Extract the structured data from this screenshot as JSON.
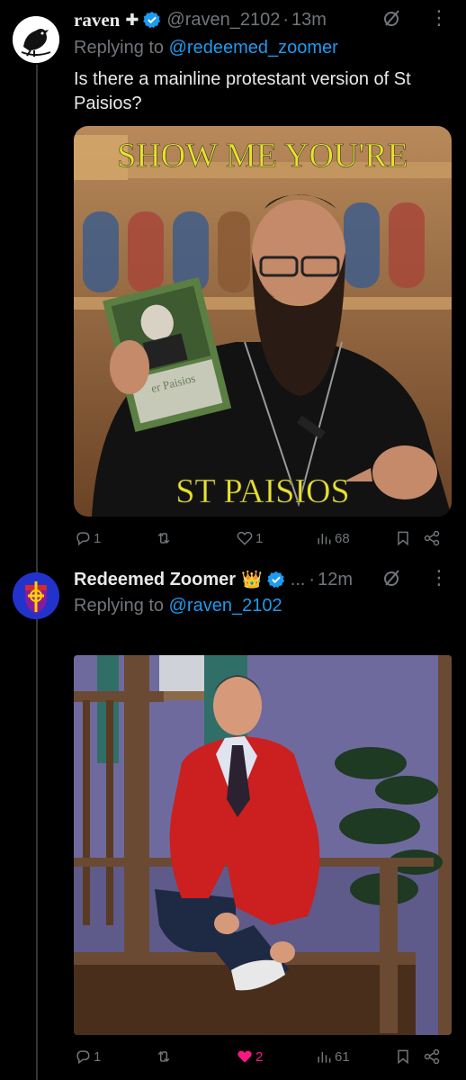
{
  "tweets": [
    {
      "name": "raven",
      "name_suffix": "✚",
      "handle": "@raven_2102",
      "time": "13m",
      "replying_prefix": "Replying to ",
      "replying_to": "@redeemed_zoomer",
      "text": "Is there a mainline protestant version of St Paisios?",
      "meme_top": "SHOW ME YOU'RE",
      "meme_bottom": "ST PAISIOS",
      "book_text": "er Paisios",
      "stats": {
        "replies": "1",
        "retweets": "",
        "likes": "1",
        "views": "68"
      }
    },
    {
      "name": "Redeemed Zoomer",
      "name_suffix": "👑",
      "handle": "...",
      "time": "12m",
      "replying_prefix": "Replying to ",
      "replying_to": "@raven_2102",
      "stats": {
        "replies": "1",
        "retweets": "",
        "likes": "2",
        "views": "61"
      }
    }
  ],
  "icons": [
    "verified-badge-icon",
    "grok-icon",
    "more-icon",
    "reply-icon",
    "retweet-icon",
    "like-icon",
    "views-icon",
    "bookmark-icon",
    "share-icon"
  ],
  "colors": {
    "accent": "#1d9bf0",
    "muted": "#71767b",
    "like": "#f91880",
    "meme_text": "#e8e22a"
  }
}
